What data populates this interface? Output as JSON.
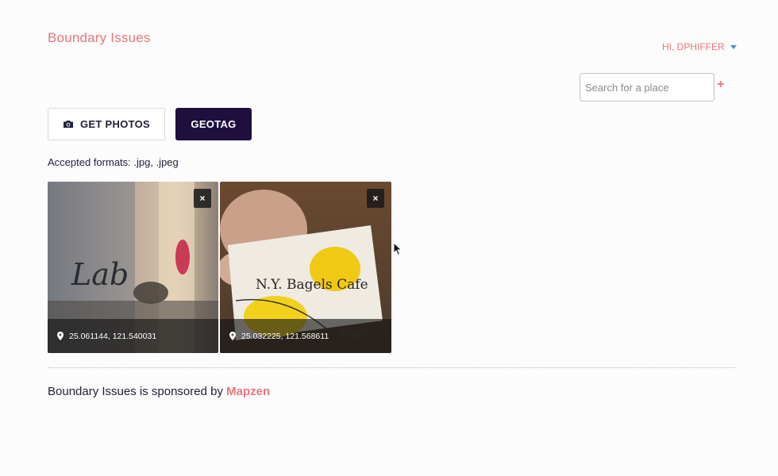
{
  "header": {
    "brand": "Boundary Issues",
    "user_menu": "HI, DPHIFFER"
  },
  "search": {
    "placeholder": "Search for a place",
    "add_label": "+"
  },
  "toolbar": {
    "get_photos_label": "GET PHOTOS",
    "get_photos_icon": "camera-icon",
    "geotag_label": "GEOTAG"
  },
  "formats_text": "Accepted formats: .jpg, .jpeg",
  "photos": [
    {
      "coords": "25.061144, 121.540031",
      "remove_label": "×"
    },
    {
      "coords": "25.032225, 121.568611",
      "remove_label": "×"
    }
  ],
  "footer": {
    "text": "Boundary Issues is sponsored by ",
    "link": "Mapzen"
  },
  "colors": {
    "accent": "#e9767a",
    "primary_button": "#1f0f3f",
    "text": "#1f1f3a"
  }
}
